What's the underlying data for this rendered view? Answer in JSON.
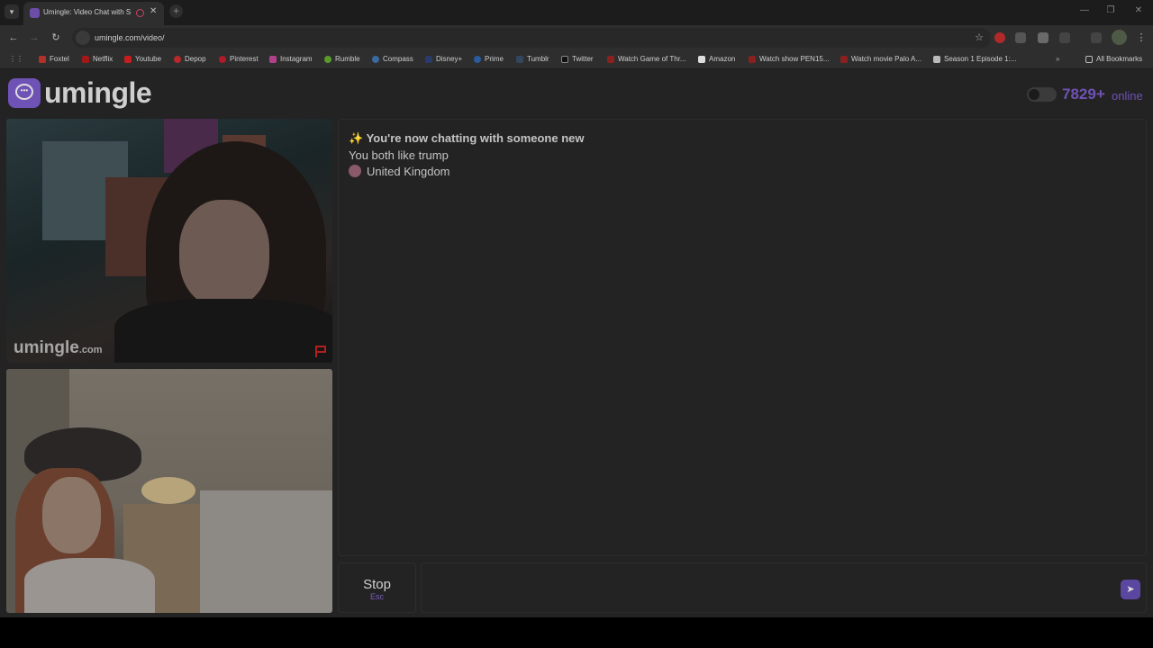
{
  "browser": {
    "tab_title": "Umingle: Video Chat with S",
    "url": "umingle.com/video/",
    "bookmarks": [
      "Foxtel",
      "Netflix",
      "Youtube",
      "Depop",
      "Pinterest",
      "Instagram",
      "Rumble",
      "Compass",
      "Disney+",
      "Prime",
      "Tumblr",
      "Twitter",
      "Watch Game of Thr...",
      "Amazon",
      "Watch show PEN15...",
      "Watch movie Palo A...",
      "Season 1 Episode 1:..."
    ],
    "all_bookmarks": "All Bookmarks"
  },
  "header": {
    "logo": "umingle",
    "online_count": "7829+",
    "online_label": "online"
  },
  "video": {
    "watermark_main": "umingle",
    "watermark_suffix": ".com"
  },
  "chat": {
    "messages": [
      "✨ You're now chatting with someone new",
      "You both like trump",
      "United Kingdom"
    ]
  },
  "controls": {
    "stop_label": "Stop",
    "stop_key": "Esc",
    "message_placeholder": ""
  },
  "colors": {
    "accent": "#6f52b5",
    "background": "#232323"
  }
}
